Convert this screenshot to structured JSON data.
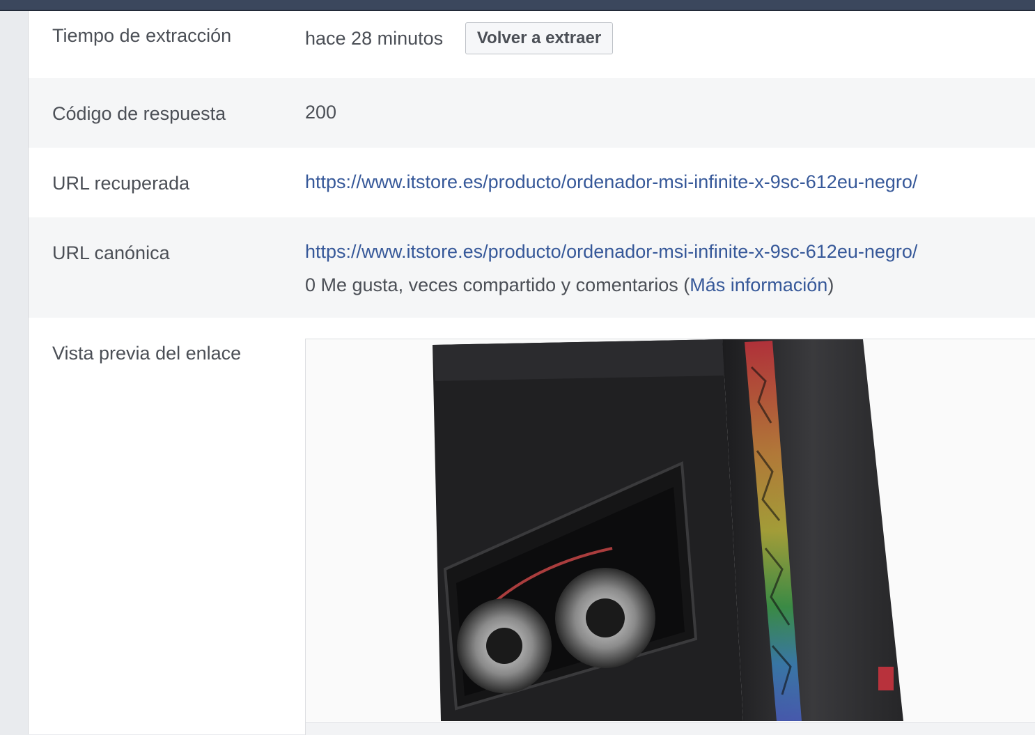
{
  "rows": {
    "fetch_time": {
      "label": "Tiempo de extracción",
      "value": "hace 28 minutos",
      "button": "Volver a extraer"
    },
    "response_code": {
      "label": "Código de respuesta",
      "value": "200"
    },
    "fetched_url": {
      "label": "URL recuperada",
      "value": "https://www.itstore.es/producto/ordenador-msi-infinite-x-9sc-612eu-negro/"
    },
    "canonical_url": {
      "label": "URL canónica",
      "value": "https://www.itstore.es/producto/ordenador-msi-infinite-x-9sc-612eu-negro/",
      "engagement_prefix": "0 Me gusta, veces compartido y comentarios (",
      "engagement_link": "Más información",
      "engagement_suffix": ")"
    },
    "link_preview": {
      "label": "Vista previa del enlace"
    }
  },
  "colors": {
    "link": "#365899",
    "text": "#4b4f56",
    "alt_row": "#f5f6f7",
    "topbar": "#3b475d"
  }
}
